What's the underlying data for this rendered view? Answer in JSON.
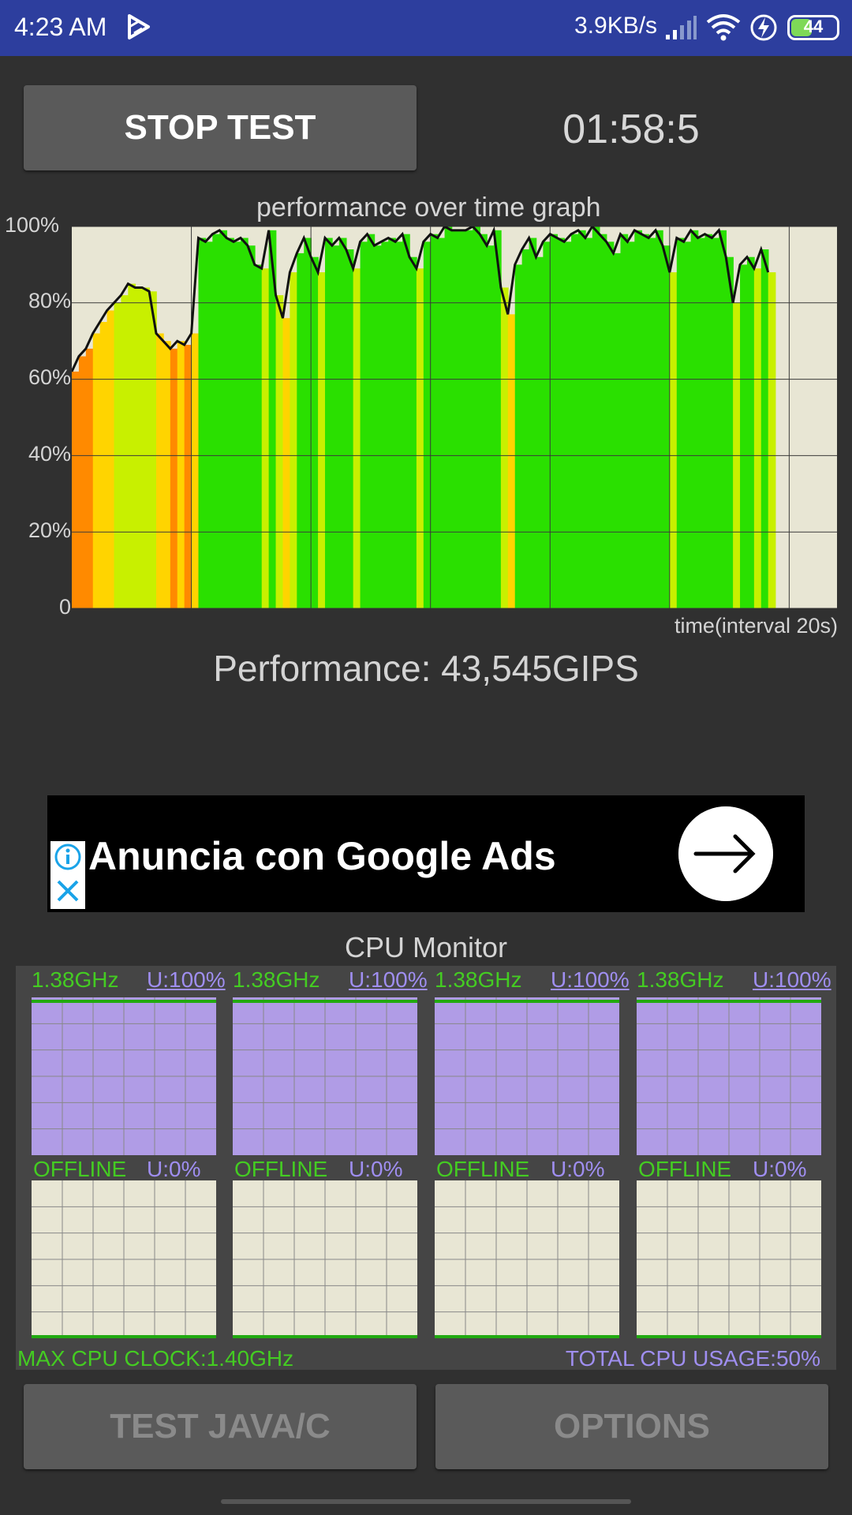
{
  "status_bar": {
    "time": "4:23 AM",
    "net_speed": "3.9KB/s",
    "battery": "44",
    "battery_level": 0.44,
    "icons": [
      "play-icon",
      "signal-icon",
      "wifi-icon",
      "charging-icon",
      "battery-icon"
    ]
  },
  "controls": {
    "stop_label": "STOP TEST",
    "timer": "01:58:5"
  },
  "chart_data": {
    "type": "area",
    "title": "performance over time graph",
    "xlabel": "time(interval 20s)",
    "ylabel": "",
    "y_ticks": [
      "100%",
      "80%",
      "60%",
      "40%",
      "20%",
      "0"
    ],
    "ylim": [
      0,
      100
    ],
    "grid": true,
    "fill_colors": [
      "#ff8a00",
      "#ffd400",
      "#c8f000",
      "#2ae000"
    ],
    "series": [
      {
        "values": [
          62,
          66,
          68,
          72,
          75,
          78,
          80,
          82,
          85,
          84,
          84,
          83,
          72,
          70,
          68,
          70,
          69,
          72,
          97,
          96,
          98,
          99,
          97,
          96,
          97,
          95,
          90,
          89,
          99,
          82,
          76,
          88,
          93,
          97,
          92,
          88,
          97,
          95,
          97,
          94,
          89,
          96,
          98,
          95,
          96,
          97,
          96,
          98,
          92,
          89,
          96,
          98,
          97,
          100,
          99,
          99,
          99,
          100,
          98,
          95,
          99,
          84,
          77,
          90,
          94,
          97,
          92,
          96,
          98,
          97,
          96,
          98,
          99,
          97,
          100,
          98,
          96,
          93,
          98,
          96,
          99,
          98,
          97,
          99,
          95,
          88,
          97,
          96,
          99,
          97,
          98,
          97,
          99,
          92,
          80,
          90,
          92,
          89,
          94,
          88
        ]
      }
    ],
    "plot_fraction": 0.91
  },
  "performance": "Performance: 43,545GIPS",
  "ad": {
    "text": "Anuncia con Google Ads",
    "icons": [
      "info-icon",
      "close-icon",
      "arrow-right-icon"
    ]
  },
  "cpu_monitor": {
    "title": "CPU Monitor",
    "cores": [
      {
        "clock": "1.38GHz",
        "usage": "U:100%",
        "active": true,
        "level": 0.98
      },
      {
        "clock": "1.38GHz",
        "usage": "U:100%",
        "active": true,
        "level": 0.98
      },
      {
        "clock": "1.38GHz",
        "usage": "U:100%",
        "active": true,
        "level": 0.98
      },
      {
        "clock": "1.38GHz",
        "usage": "U:100%",
        "active": true,
        "level": 0.98
      },
      {
        "clock": "OFFLINE",
        "usage": "U:0%",
        "active": false,
        "level": 0.0
      },
      {
        "clock": "OFFLINE",
        "usage": "U:0%",
        "active": false,
        "level": 0.0
      },
      {
        "clock": "OFFLINE",
        "usage": "U:0%",
        "active": false,
        "level": 0.0
      },
      {
        "clock": "OFFLINE",
        "usage": "U:0%",
        "active": false,
        "level": 0.0
      }
    ],
    "max_clock": "MAX CPU CLOCK:1.40GHz",
    "total_usage": "TOTAL CPU USAGE:50%"
  },
  "buttons": {
    "test_label": "TEST JAVA/C",
    "options_label": "OPTIONS"
  }
}
